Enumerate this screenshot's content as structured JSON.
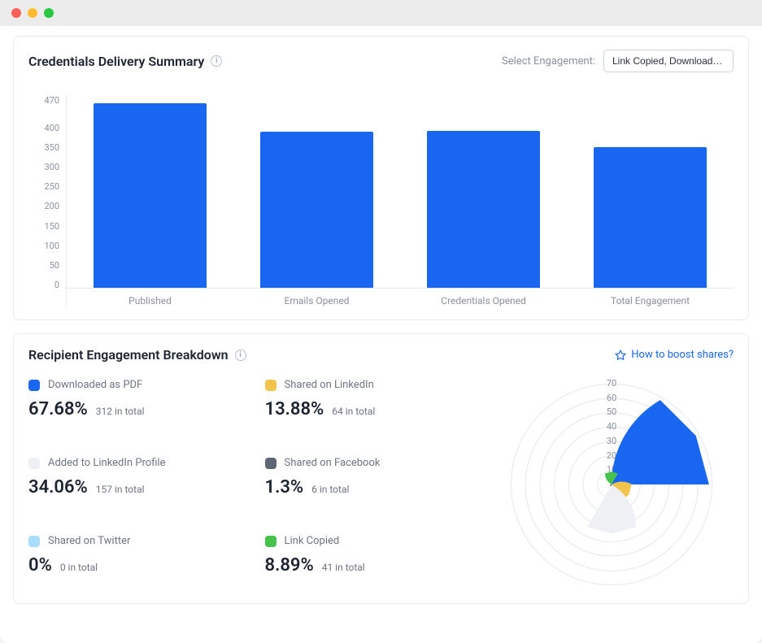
{
  "summary": {
    "title": "Credentials Delivery Summary",
    "select_label": "Select Engagement:",
    "select_value": "Link Copied, Downloaded..."
  },
  "breakdown": {
    "title": "Recipient Engagement Breakdown",
    "boost_link": "How to boost shares?"
  },
  "stats": [
    {
      "name": "Downloaded as PDF",
      "percent": "67.68%",
      "total": "312 in total",
      "color": "#1966f0"
    },
    {
      "name": "Shared on LinkedIn",
      "percent": "13.88%",
      "total": "64 in total",
      "color": "#f2c44b"
    },
    {
      "name": "Added to LinkedIn Profile",
      "percent": "34.06%",
      "total": "157 in total",
      "color": "#eef0f4"
    },
    {
      "name": "Shared on Facebook",
      "percent": "1.3%",
      "total": "6 in total",
      "color": "#5f6775"
    },
    {
      "name": "Shared on Twitter",
      "percent": "0%",
      "total": "0 in total",
      "color": "#a9defb"
    },
    {
      "name": "Link Copied",
      "percent": "8.89%",
      "total": "41 in total",
      "color": "#46c34a"
    }
  ],
  "chart_data": [
    {
      "type": "bar",
      "title": "Credentials Delivery Summary",
      "categories": [
        "Published",
        "Emails Opened",
        "Credentials Opened",
        "Total Engagement"
      ],
      "values": [
        462,
        390,
        392,
        352
      ],
      "ylim": [
        0,
        470
      ],
      "yticks": [
        470,
        400,
        350,
        300,
        250,
        200,
        150,
        100,
        50,
        0
      ],
      "series_color": "#1966f0"
    },
    {
      "type": "polar",
      "title": "Recipient Engagement Breakdown",
      "rlim": [
        0,
        70
      ],
      "rticks": [
        10,
        20,
        30,
        40,
        50,
        60,
        70
      ],
      "series": [
        {
          "name": "Downloaded as PDF",
          "value": 67.68,
          "color": "#1966f0"
        },
        {
          "name": "Shared on LinkedIn",
          "value": 13.88,
          "color": "#f2c44b"
        },
        {
          "name": "Added to LinkedIn Profile",
          "value": 34.06,
          "color": "#eef0f4"
        },
        {
          "name": "Shared on Facebook",
          "value": 1.3,
          "color": "#5f6775"
        },
        {
          "name": "Shared on Twitter",
          "value": 0,
          "color": "#a9defb"
        },
        {
          "name": "Link Copied",
          "value": 8.89,
          "color": "#46c34a"
        }
      ]
    }
  ]
}
